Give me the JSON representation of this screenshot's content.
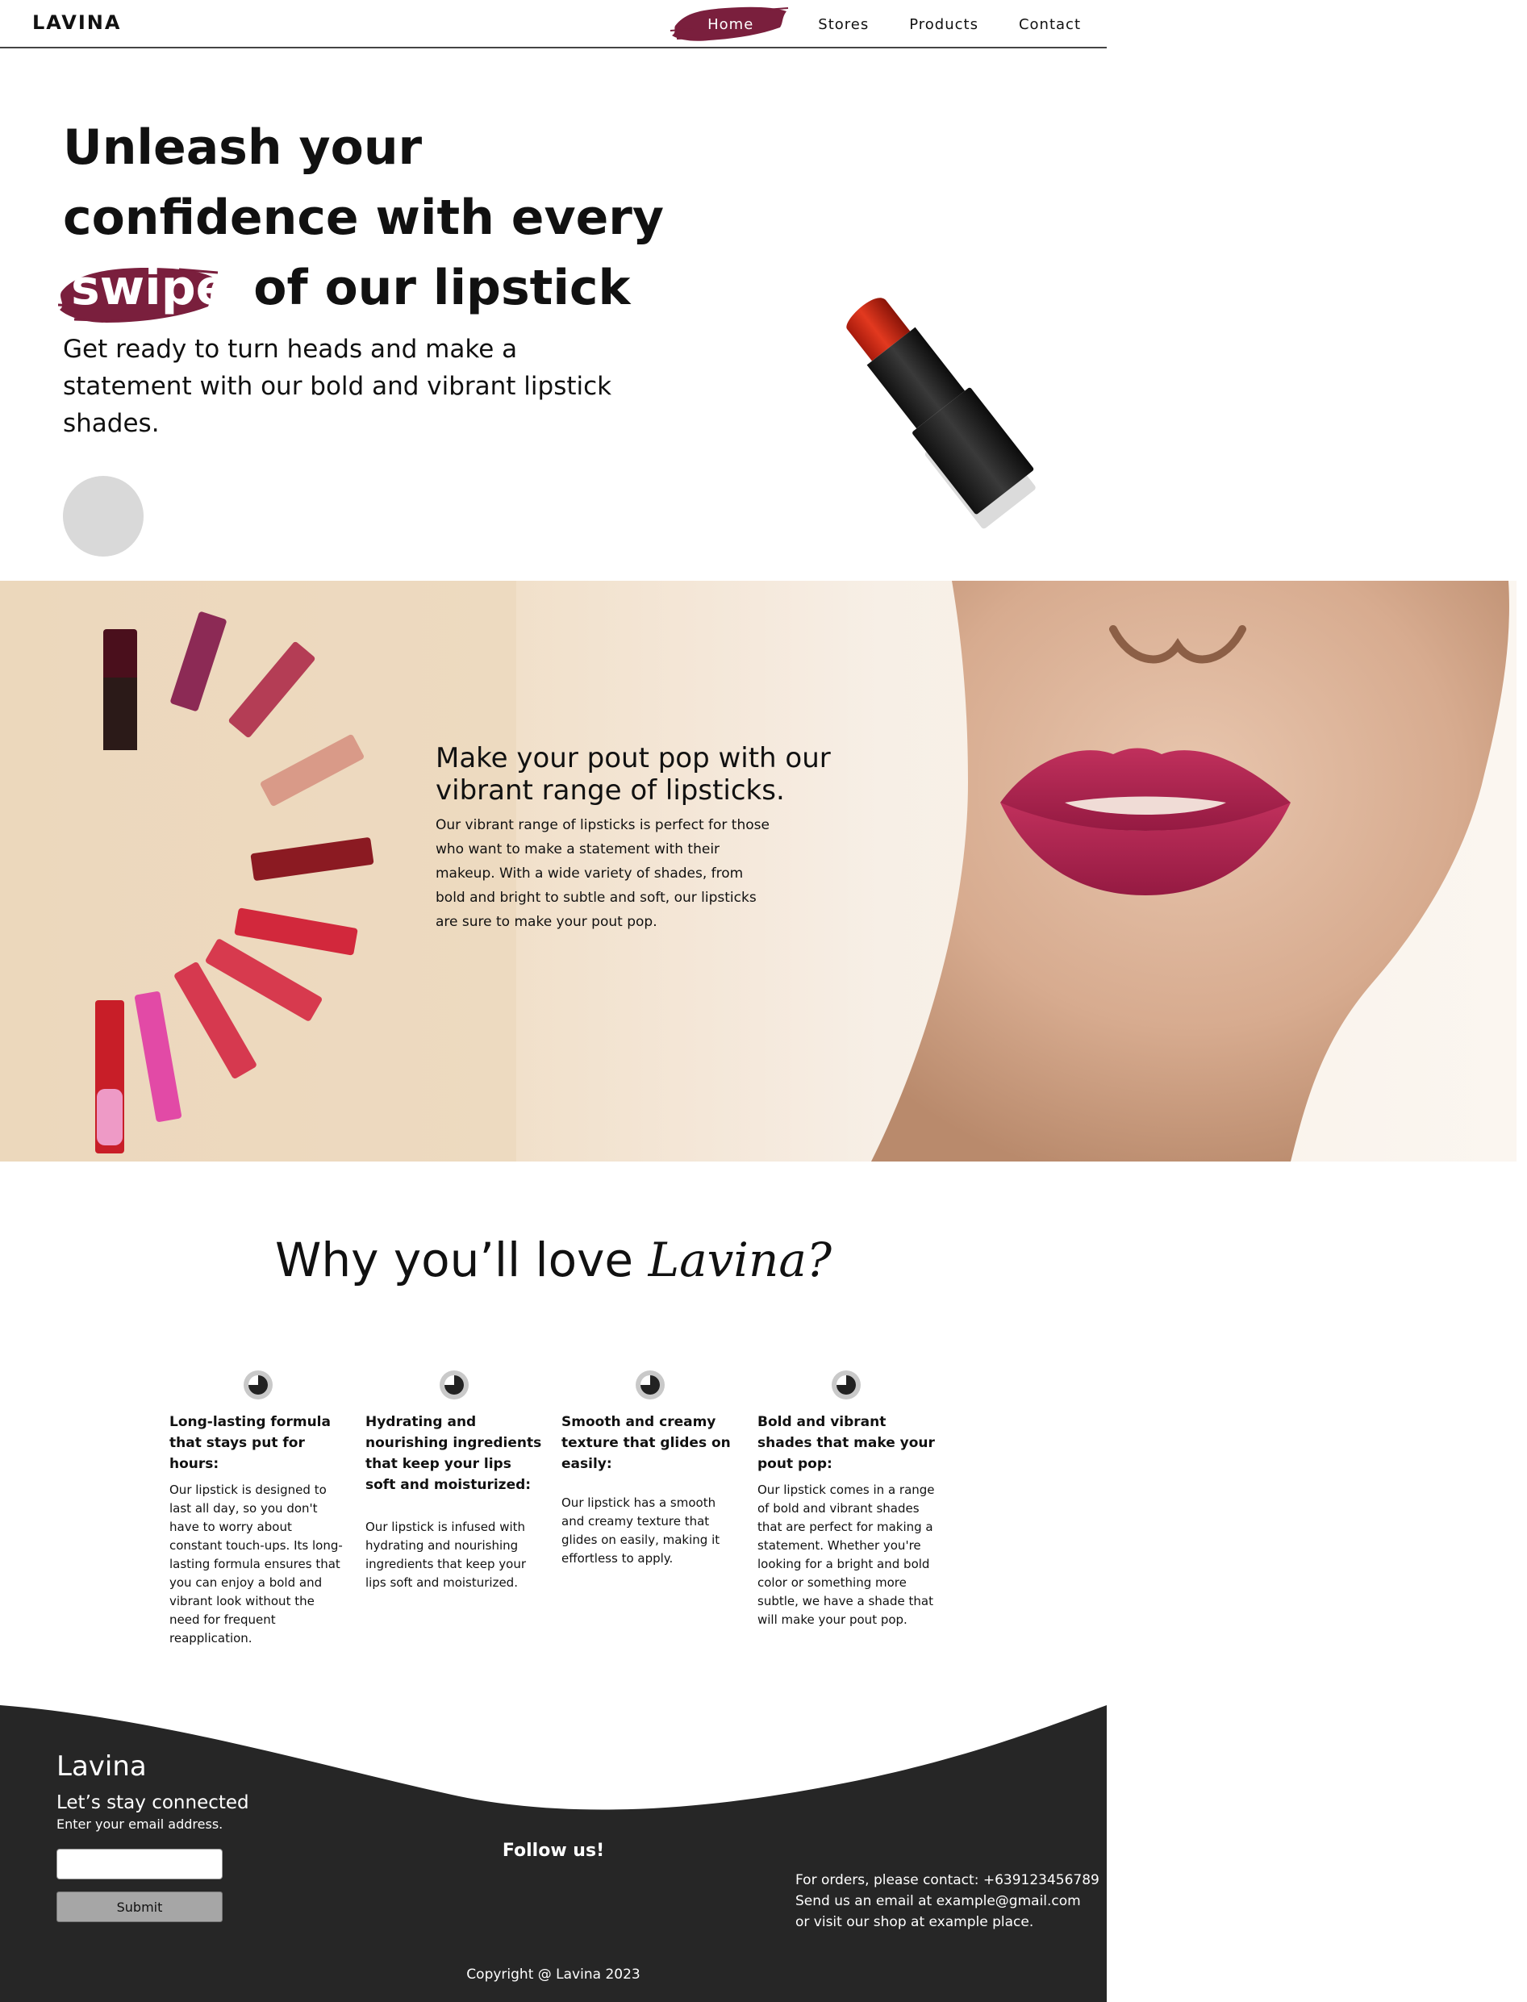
{
  "nav": {
    "brand": "LAVINA",
    "links": [
      "Home",
      "Stores",
      "Products",
      "Contact"
    ],
    "active_index": 0
  },
  "hero": {
    "title_before": "Unleash your confidence with every",
    "title_highlight": "swipe",
    "title_after": "of our lipstick",
    "subtitle": "Get ready to turn heads and make a statement with our bold and vibrant lipstick shades."
  },
  "promo": {
    "title": "Make your pout pop with our vibrant range of lipsticks.",
    "text": "Our vibrant range of lipsticks is perfect for those who want to make a statement with their makeup. With a wide variety of shades, from bold and bright to subtle and soft, our lipsticks are sure to make your pout pop."
  },
  "why": {
    "title": "Why you’ll love",
    "brand_script": "Lavina?",
    "features": [
      {
        "title": "Long-lasting formula that stays put for hours:",
        "text": "Our lipstick is designed to last all day, so you don't have to worry about constant touch-ups. Its long-lasting formula ensures that you can enjoy a bold and vibrant look without the need for frequent reapplication."
      },
      {
        "title": "Hydrating and nourishing ingredients that keep your lips soft and moisturized:",
        "text": "Our lipstick is infused with hydrating and nourishing ingredients that keep your lips soft and moisturized."
      },
      {
        "title": "Smooth and creamy texture that glides on easily:",
        "text": "Our lipstick has a smooth and creamy texture that glides on easily, making it effortless to apply."
      },
      {
        "title": "Bold and vibrant shades that make your pout pop:",
        "text": "Our lipstick comes in a range of bold and vibrant shades that are perfect for making a statement. Whether you're looking for a bright and bold color or something more subtle, we have a shade that will make your pout pop."
      }
    ]
  },
  "footer": {
    "brand": "Lavina",
    "connect": "Let’s stay connected",
    "email_hint": "Enter your email address.",
    "email_value": "",
    "submit_label": "Submit",
    "follow": "Follow us!",
    "contact_lines": [
      "For orders, please contact: +639123456789",
      "Send us an email at example@gmail.com",
      "or visit our shop at example place."
    ],
    "copyright": "Copyright @ Lavina 2023"
  },
  "colors": {
    "accent": "#7a1f3d",
    "footer_bg": "#262626",
    "lip": "#b0234f"
  },
  "icons": [
    "brush-stroke-icon",
    "lipstick-image",
    "lips-image",
    "clock-icon"
  ]
}
